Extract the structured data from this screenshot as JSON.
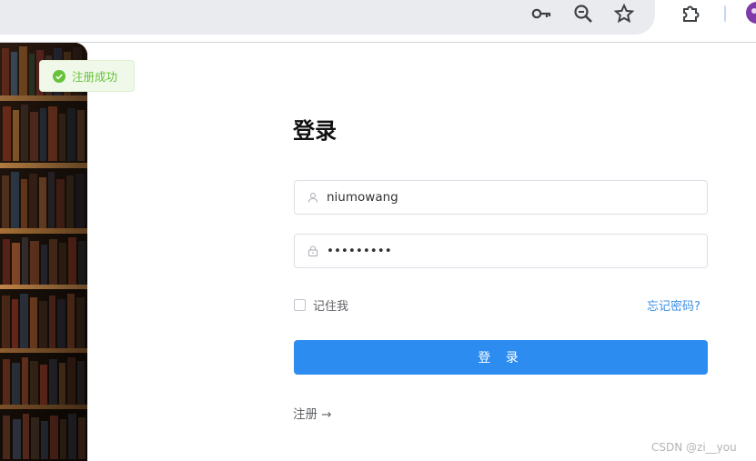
{
  "browser": {
    "icons": [
      "key-icon",
      "zoom-icon",
      "star-icon",
      "puzzle-icon",
      "profile-avatar"
    ]
  },
  "toast": {
    "message": "注册成功",
    "color": "#67c23a"
  },
  "form": {
    "title": "登录",
    "username": {
      "value": "niumowang"
    },
    "password": {
      "value": "•••••••••"
    },
    "remember_label": "记住我",
    "forgot_label": "忘记密码?",
    "login_label": "登 录",
    "register_label": "注册 →"
  },
  "watermark": "CSDN @zi__you",
  "colors": {
    "primary": "#2d8cf0",
    "link": "#3a8ee6",
    "success": "#67c23a"
  }
}
